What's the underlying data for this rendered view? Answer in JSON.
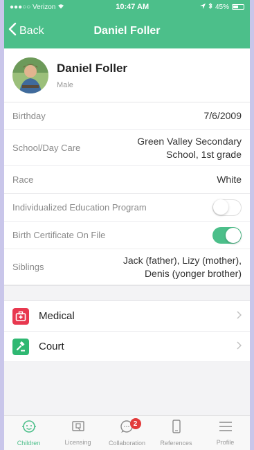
{
  "status_bar": {
    "carrier": "●●●○○ Verizon",
    "time": "10:47 AM",
    "battery": "45%",
    "battery_level": 0.45
  },
  "nav": {
    "back_label": "Back",
    "title": "Daniel Foller"
  },
  "profile": {
    "name": "Daniel Foller",
    "gender": "Male"
  },
  "details": {
    "birthday_label": "Birthday",
    "birthday_value": "7/6/2009",
    "school_label": "School/Day Care",
    "school_value_line1": "Green Valley Secondary",
    "school_value_line2": "School, 1st grade",
    "race_label": "Race",
    "race_value": "White",
    "iep_label": "Individualized Education Program",
    "iep_on": false,
    "birth_cert_label": "Birth Certificate On File",
    "birth_cert_on": true,
    "siblings_label": "Siblings",
    "siblings_value_line1": "Jack (father), Lizy (mother),",
    "siblings_value_line2": "Denis (yonger brother)"
  },
  "menu": [
    {
      "label": "Medical",
      "icon": "medical-kit-icon",
      "color": "#e8384f"
    },
    {
      "label": "Court",
      "icon": "gavel-icon",
      "color": "#2fb872"
    }
  ],
  "tabs": [
    {
      "label": "Children",
      "icon": "children-icon",
      "active": true
    },
    {
      "label": "Licensing",
      "icon": "licensing-icon",
      "active": false
    },
    {
      "label": "Collaboration",
      "icon": "collaboration-icon",
      "active": false,
      "badge": "2"
    },
    {
      "label": "References",
      "icon": "references-icon",
      "active": false
    },
    {
      "label": "Profile",
      "icon": "profile-menu-icon",
      "active": false
    }
  ],
  "colors": {
    "accent": "#4cbf8a",
    "background": "#c9c6ea",
    "badge": "#e23b3b"
  }
}
